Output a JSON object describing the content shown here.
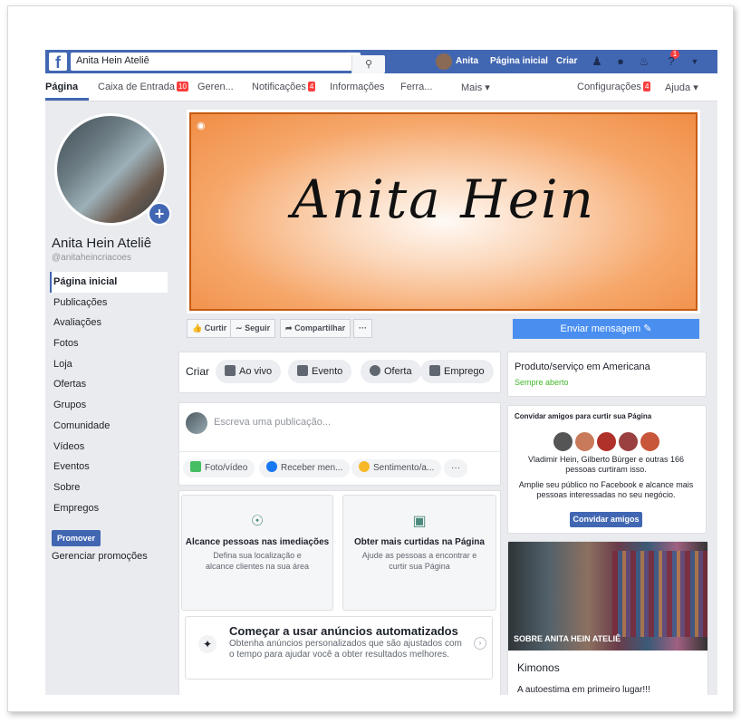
{
  "topbar": {
    "search_value": "Anita Hein Ateliê",
    "user_name": "Anita",
    "home_link": "Página inicial",
    "create_link": "Criar",
    "notifications_count": "1"
  },
  "tabs": {
    "pagina": "Página",
    "caixa": "Caixa de Entrada",
    "caixa_badge": "10",
    "gerenciar": "Geren...",
    "notificacoes": "Notificações",
    "notificacoes_badge": "4",
    "informacoes": "Informações",
    "ferramentas": "Ferra...",
    "mais": "Mais ▾",
    "configuracoes": "Configurações",
    "configuracoes_badge": "4",
    "ajuda": "Ajuda ▾"
  },
  "page": {
    "name": "Anita Hein Ateliê",
    "handle": "@anitaheincriacoes",
    "cover_text": "Anita Hein"
  },
  "nav": [
    "Página inicial",
    "Publicações",
    "Avaliações",
    "Fotos",
    "Loja",
    "Ofertas",
    "Grupos",
    "Comunidade",
    "Vídeos",
    "Eventos",
    "Sobre",
    "Empregos"
  ],
  "left": {
    "promote": "Promover",
    "manage_promotions": "Gerenciar promoções"
  },
  "actions": {
    "like": "Curtir",
    "follow": "Seguir",
    "share": "Compartilhar",
    "more": "···",
    "send_message": "Enviar mensagem"
  },
  "create": {
    "label": "Criar",
    "live": "Ao vivo",
    "event": "Evento",
    "offer": "Oferta",
    "job": "Emprego"
  },
  "composer": {
    "placeholder": "Escreva uma publicação...",
    "photo": "Foto/vídeo",
    "messages": "Receber men...",
    "feeling": "Sentimento/a...",
    "more": "···"
  },
  "promo_cards": [
    {
      "title": "Alcance pessoas nas imediações",
      "desc": "Defina sua localização e alcance clientes na sua área"
    },
    {
      "title": "Obter mais curtidas na Página",
      "desc": "Ajude as pessoas a encontrar e curtir sua Página"
    }
  ],
  "auto_ads": {
    "title": "Começar a usar anúncios automatizados",
    "desc": "Obtenha anúncios personalizados que são ajustados com o tempo para ajudar você a obter resultados melhores."
  },
  "right": {
    "category": "Produto/serviço em Americana",
    "hours": "Sempre aberto",
    "invite_title": "Convidar amigos para curtir sua Página",
    "invite_text": "Vladimir Hein, Gilberto Bürger e outras 166 pessoas curtiram isso.",
    "invite_text2": "Amplie seu público no Facebook e alcance mais pessoas interessadas no seu negócio.",
    "invite_button": "Convidar amigos",
    "about_label": "SOBRE ANITA HEIN ATELIÊ",
    "about_title": "Kimonos",
    "about_text": "A autoestima em primeiro lugar!!!"
  },
  "colors": {
    "brand": "#4267b2",
    "send_button": "#4a8ff0",
    "badge": "#fa3e3e",
    "cover_border": "#c65b12"
  }
}
